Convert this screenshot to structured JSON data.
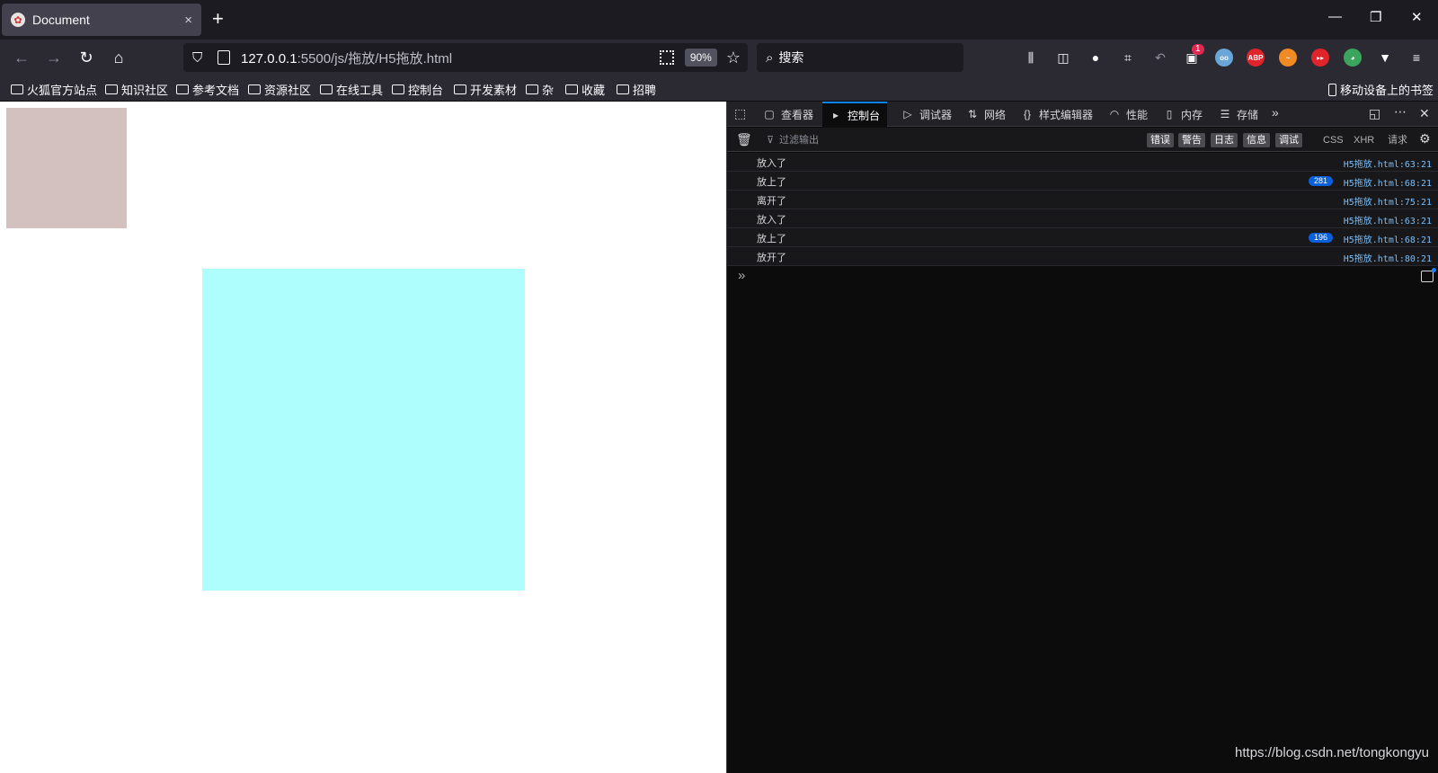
{
  "tab": {
    "title": "Document",
    "favicon": "fox-favicon-icon",
    "close": "×"
  },
  "window": {
    "minimize": "—",
    "restore": "❐",
    "close": "✕",
    "new_tab": "+"
  },
  "nav": {
    "back": "←",
    "forward": "→",
    "reload": "↻",
    "home": "⌂",
    "url_host": "127.0.0.1",
    "url_rest": ":5500/js/拖放/H5拖放.html",
    "zoom": "90%",
    "search_placeholder": "搜索",
    "extension_badge": "1"
  },
  "bookmarks": {
    "items": [
      "火狐官方站点",
      "知识社区",
      "参考文档",
      "资源社区",
      "在线工具",
      "控制台",
      "开发素材",
      "杂",
      "收藏",
      "招聘"
    ],
    "mobile": "移动设备上的书签"
  },
  "devtools": {
    "tabs": [
      "查看器",
      "控制台",
      "调试器",
      "网络",
      "样式编辑器",
      "性能",
      "内存",
      "存储"
    ],
    "active_tab": "控制台",
    "filter_placeholder": "过滤输出",
    "levels": [
      "错误",
      "警告",
      "日志",
      "信息",
      "调试"
    ],
    "extra_filters": [
      "CSS",
      "XHR",
      "请求"
    ],
    "logs": [
      {
        "message": "放入了",
        "count": "",
        "source": "H5拖放.html:63:21"
      },
      {
        "message": "放上了",
        "count": "281",
        "source": "H5拖放.html:68:21"
      },
      {
        "message": "离开了",
        "count": "",
        "source": "H5拖放.html:75:21"
      },
      {
        "message": "放入了",
        "count": "",
        "source": "H5拖放.html:63:21"
      },
      {
        "message": "放上了",
        "count": "196",
        "source": "H5拖放.html:68:21"
      },
      {
        "message": "放开了",
        "count": "",
        "source": "H5拖放.html:80:21"
      }
    ],
    "prompt": "»"
  },
  "watermark": "https://blog.csdn.net/tongkongyu",
  "colors": {
    "drag_box": "#d3c1c0",
    "drop_zone": "#affefe",
    "accent": "#0a84ff"
  }
}
